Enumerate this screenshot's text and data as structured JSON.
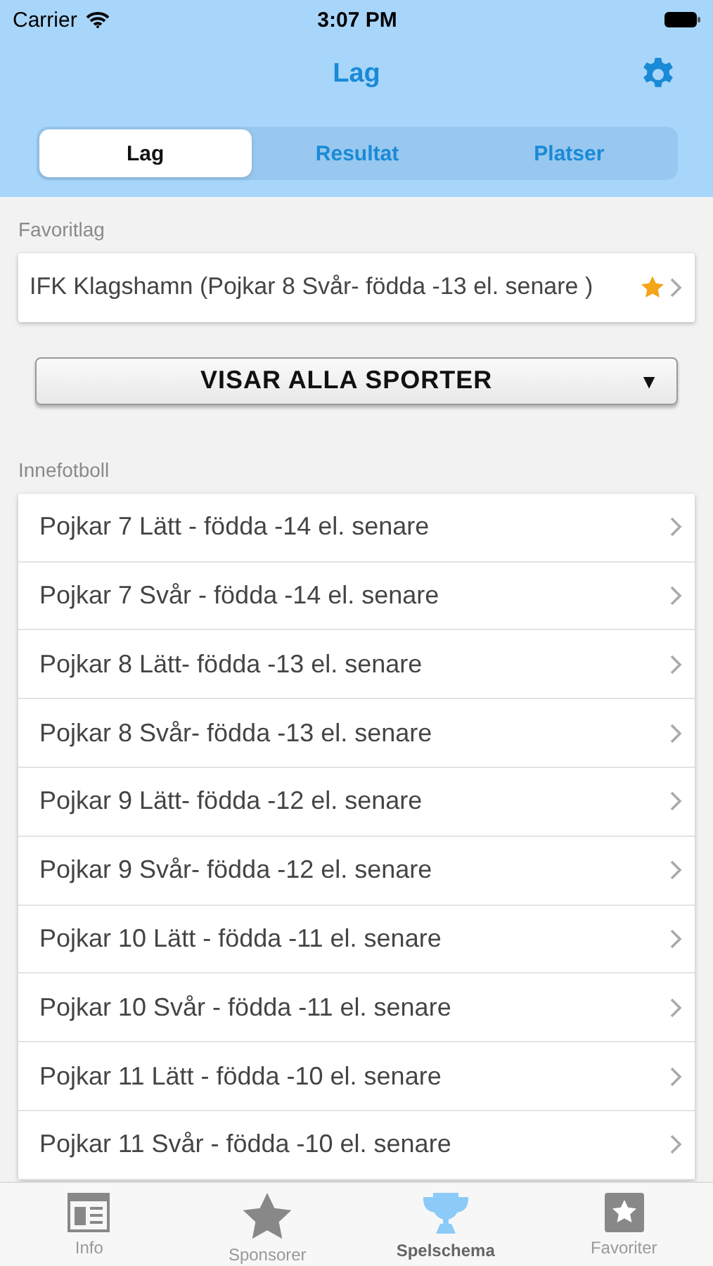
{
  "status_bar": {
    "carrier": "Carrier",
    "time": "3:07 PM"
  },
  "nav": {
    "title": "Lag"
  },
  "segments": [
    {
      "label": "Lag",
      "selected": true
    },
    {
      "label": "Resultat",
      "selected": false
    },
    {
      "label": "Platser",
      "selected": false
    }
  ],
  "favorites": {
    "header": "Favoritlag",
    "items": [
      {
        "label": "IFK Klagshamn (Pojkar 8 Svår- födda -13 el. senare )",
        "starred": true
      }
    ]
  },
  "sport_filter": {
    "label": "VISAR ALLA SPORTER",
    "arrow": "▼"
  },
  "section": {
    "header": "Innefotboll",
    "items": [
      "Pojkar 7 Lätt - födda -14 el. senare",
      "Pojkar 7 Svår - födda -14 el. senare",
      "Pojkar 8 Lätt- födda -13 el. senare",
      "Pojkar 8 Svår- födda -13 el. senare",
      "Pojkar 9 Lätt- födda -12 el. senare",
      "Pojkar 9 Svår- födda -12 el. senare",
      "Pojkar 10 Lätt - födda -11 el. senare",
      "Pojkar 10 Svår - födda -11 el. senare",
      "Pojkar 11 Lätt - födda -10 el. senare",
      "Pojkar 11 Svår - födda -10 el. senare"
    ]
  },
  "tab_bar": [
    {
      "label": "Info",
      "kind": "info",
      "selected": false
    },
    {
      "label": "Sponsorer",
      "kind": "star",
      "selected": false
    },
    {
      "label": "Spelschema",
      "kind": "trophy",
      "selected": true
    },
    {
      "label": "Favoriter",
      "kind": "favorites",
      "selected": false
    }
  ]
}
